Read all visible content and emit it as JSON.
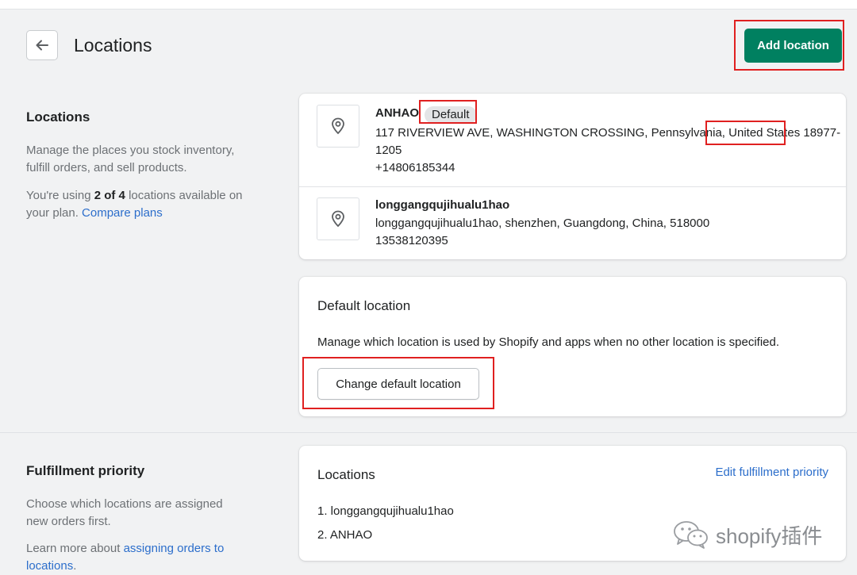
{
  "header": {
    "title": "Locations",
    "add_button": "Add location"
  },
  "locations_section": {
    "title": "Locations",
    "description": "Manage the places you stock inventory, fulfill orders, and sell products.",
    "usage_prefix": "You're using ",
    "usage_count": "2 of 4",
    "usage_suffix": " locations available on your plan. ",
    "compare_link": "Compare plans"
  },
  "locations": [
    {
      "name": "ANHAO",
      "badge": "Default",
      "address_before_country": "117 RIVERVIEW AVE, WASHINGTON CROSSING, Pennsylvania, ",
      "country": "United States",
      "address_after_country": " 18977-",
      "address_line2": "1205",
      "phone": "+14806185344"
    },
    {
      "name": "longgangqujihualu1hao",
      "address": "longgangqujihualu1hao, shenzhen, Guangdong, China, 518000",
      "phone": "13538120395"
    }
  ],
  "default_location": {
    "title": "Default location",
    "description": "Manage which location is used by Shopify and apps when no other location is specified.",
    "button": "Change default location"
  },
  "fulfillment_section": {
    "title": "Fulfillment priority",
    "description": "Choose which locations are assigned new orders first.",
    "learn_prefix": "Learn more about ",
    "learn_link": "assigning orders to locations",
    "learn_suffix": "."
  },
  "fulfillment_card": {
    "title": "Locations",
    "edit_link": "Edit fulfillment priority",
    "items": [
      "1.  longgangqujihualu1hao",
      "2.  ANHAO"
    ]
  },
  "watermark": {
    "text": "shopify插件",
    "icon": "wechat-icon"
  },
  "colors": {
    "primary": "#008060",
    "link": "#2c6ecb",
    "highlight": "#e02020"
  }
}
